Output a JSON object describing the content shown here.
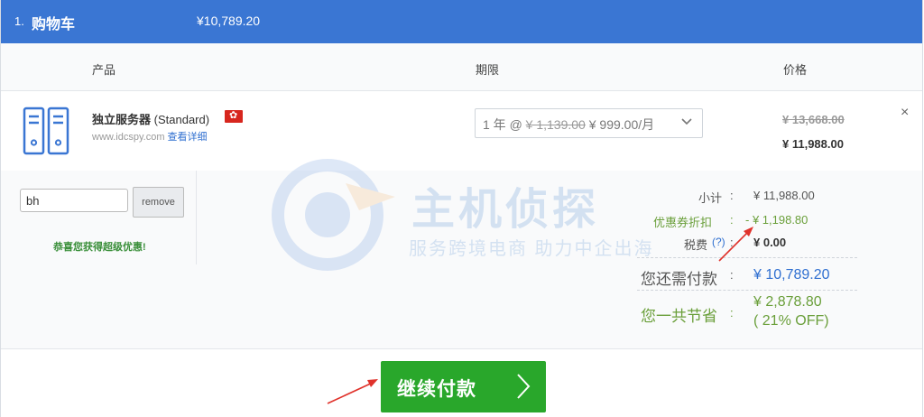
{
  "header": {
    "step": "1.",
    "title": "购物车",
    "total": "¥10,789.20"
  },
  "columns": {
    "product": "产品",
    "period": "期限",
    "price": "价格"
  },
  "item": {
    "name": "独立服务器",
    "plan": "(Standard)",
    "flag_icon": "hong-kong-flag-icon",
    "flag_glyph": "✿",
    "site": "www.idcspy.com",
    "details_link": "查看详细",
    "period_prefix": "1 年 @ ",
    "period_old": "¥ 1,139.00",
    "period_new": " ¥ 999.00/月",
    "price_old": "¥ 13,668.00",
    "price_new": "¥ 11,988.00",
    "remove_glyph": "×"
  },
  "promo": {
    "code": "bh",
    "remove_label": "remove",
    "message": "恭喜您获得超级优惠!"
  },
  "summary": {
    "subtotal_label": "小计",
    "subtotal_value": "¥ 11,988.00",
    "coupon_label": "优惠券折扣",
    "coupon_value": "- ¥ 1,198.80",
    "tax_label": "税费",
    "tax_help": "(?)",
    "tax_value": "¥ 0.00",
    "due_label": "您还需付款",
    "due_value": "¥ 10,789.20",
    "saved_label": "您一共节省",
    "saved_value": "¥ 2,878.80",
    "saved_pct": "( 21% OFF)",
    "colon": ":"
  },
  "watermark": {
    "title": "主机侦探",
    "subtitle": "服务跨境电商 助力中企出海"
  },
  "checkout": {
    "label": "继续付款",
    "arrow": "›"
  },
  "colors": {
    "header_bg": "#3a76d3",
    "button_green": "#29a72b",
    "accent_blue": "#2f6fd0",
    "discount_green": "#6a9f3a",
    "annotation_red": "#e0322b"
  }
}
